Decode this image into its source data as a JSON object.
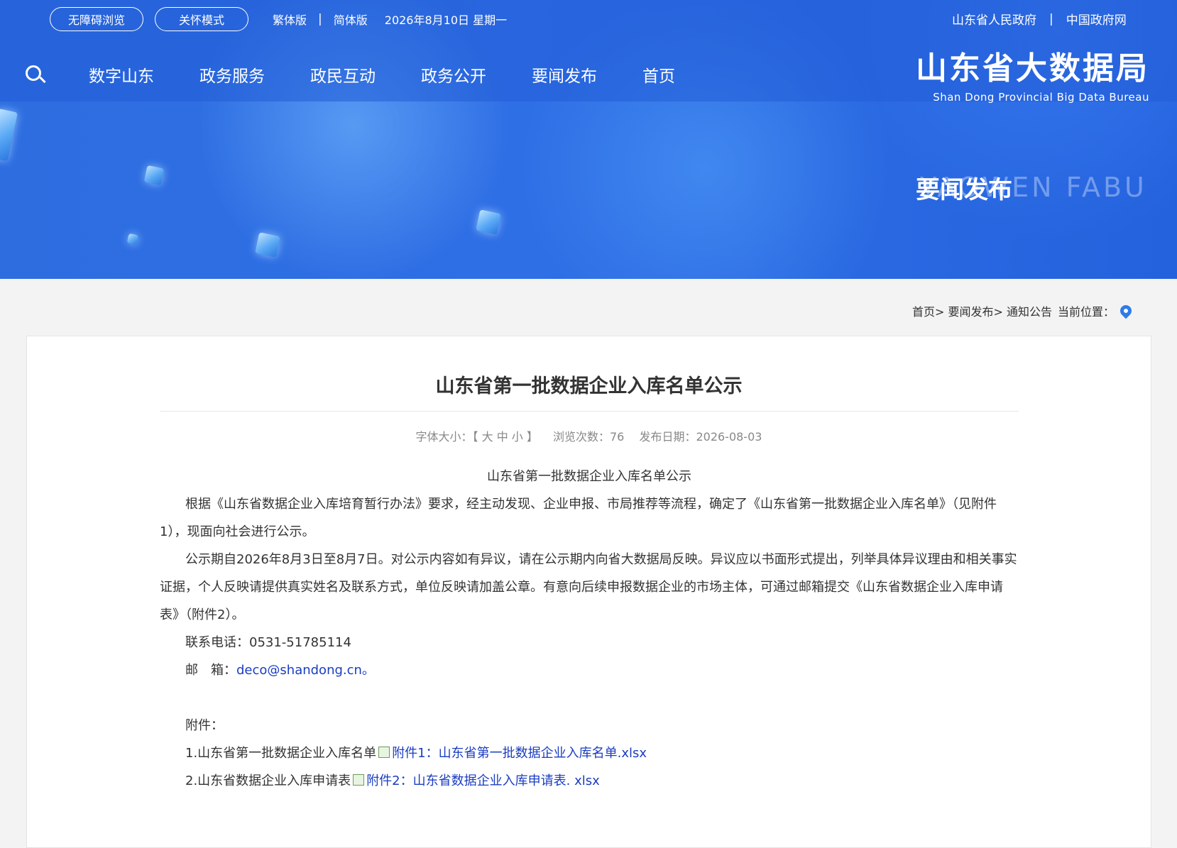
{
  "header": {
    "links": [
      "中国政府网",
      "山东省人民政府"
    ],
    "date": "2026年8月10日 星期一",
    "version_links": [
      "简体版",
      "繁体版"
    ],
    "buttons": [
      "关怀模式",
      "无障碍浏览"
    ],
    "brand_cn": "山东省大数据局",
    "brand_en": "Shan Dong Provincial Big Data Bureau"
  },
  "nav": [
    "首页",
    "要闻发布",
    "政务公开",
    "政民互动",
    "政务服务",
    "数字山东"
  ],
  "banner": {
    "section_title": "要闻发布",
    "section_en": "YAOWEN FABU"
  },
  "breadcrumb": {
    "label": "当前位置：",
    "path": "首页> 要闻发布> 通知公告"
  },
  "article": {
    "title": "山东省第一批数据企业入库名单公示",
    "meta": {
      "date": "发布日期：2026-08-03",
      "views": "浏览次数：76",
      "font_size": "字体大小：【 大 中 小 】"
    },
    "subtitle": "山东省第一批数据企业入库名单公示",
    "para1": "根据《山东省数据企业入库培育暂行办法》要求，经主动发现、企业申报、市局推荐等流程，确定了《山东省第一批数据企业入库名单》（见附件1），现面向社会进行公示。",
    "para2": "公示期自2026年8月3日至8月7日。对公示内容如有异议，请在公示期内向省大数据局反映。异议应以书面形式提出，列举具体异议理由和相关事实证据，个人反映请提供真实姓名及联系方式，单位反映请加盖公章。有意向后续申报数据企业的市场主体，可通过邮箱提交《山东省数据企业入库申请表》（附件2）。",
    "phone": "联系电话：0531-51785114",
    "email_label": "邮　箱：",
    "email": "deco@shandong.cn。",
    "attach_label": "附件：",
    "attachments": [
      {
        "prefix": "1.山东省第一批数据企业入库名单",
        "link": "附件1：山东省第一批数据企业入库名单.xlsx"
      },
      {
        "prefix": "2.山东省数据企业入库申请表",
        "link": "附件2：山东省数据企业入库申请表. xlsx"
      }
    ]
  }
}
